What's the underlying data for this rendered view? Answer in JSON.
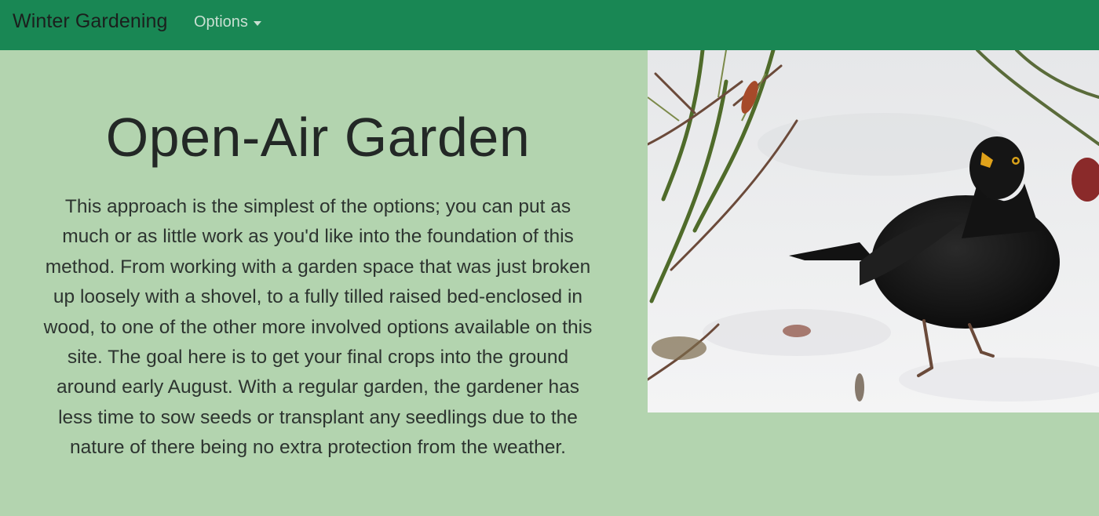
{
  "navbar": {
    "brand": "Winter Gardening",
    "options_label": "Options"
  },
  "main": {
    "title": "Open-Air Garden",
    "body": "This approach is the simplest of the options; you can put as much or as little work as you'd like into the foundation of this method. From working with a garden space that was just broken up loosely with a shovel, to a fully tilled raised bed-enclosed in wood, to one of the other more involved options available on this site. The goal here is to get your final crops into the ground around early August. With a regular garden, the gardener has less time to sow seeds or transplant any seedlings due to the nature of there being no extra protection from the weather."
  },
  "image": {
    "subject": "blackbird-in-snow-photo"
  },
  "colors": {
    "navbar": "#198754",
    "page_background": "#b3d4af",
    "text": "#232826"
  }
}
